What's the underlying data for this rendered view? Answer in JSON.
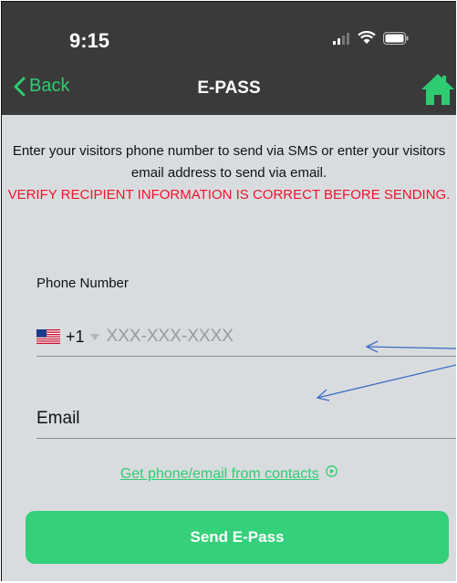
{
  "status_bar": {
    "time": "9:15"
  },
  "nav": {
    "back_label": "Back",
    "title": "E-PASS"
  },
  "instructions": {
    "text": "Enter your visitors phone number to send via SMS or enter your visitors email address to send via email.",
    "warning": "VERIFY RECIPIENT INFORMATION IS CORRECT BEFORE SENDING."
  },
  "phone": {
    "label": "Phone Number",
    "country_code": "+1",
    "placeholder": "XXX-XXX-XXXX"
  },
  "email": {
    "placeholder": "Email"
  },
  "contacts_link": {
    "label": "Get phone/email from contacts"
  },
  "send_button": {
    "label": "Send E-Pass"
  },
  "icons": {
    "back": "chevron-left-icon",
    "home": "home-icon",
    "signal": "cellular-signal-icon",
    "wifi": "wifi-icon",
    "battery": "battery-icon",
    "flag": "us-flag-icon",
    "caret": "caret-down-icon",
    "play": "play-circle-icon"
  },
  "colors": {
    "accent": "#2ecc71",
    "button": "#34d07a",
    "warning": "#f0142c",
    "header": "#3a3a3a",
    "background": "#d9dcdf",
    "annotation_arrow": "#3b6dc4"
  }
}
